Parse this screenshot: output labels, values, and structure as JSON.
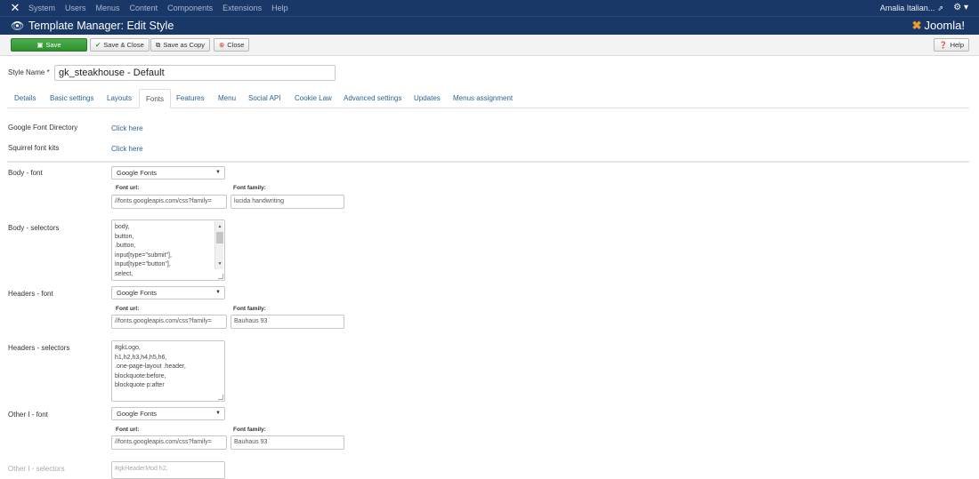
{
  "topnav": {
    "logo_icon": "joomla-x-icon",
    "menu": [
      "System",
      "Users",
      "Menus",
      "Content",
      "Components",
      "Extensions",
      "Help"
    ],
    "user": "Amalia Italian...",
    "settings_icon": "gear-icon"
  },
  "header": {
    "title": "Template Manager: Edit Style",
    "brand": "Joomla!"
  },
  "toolbar": {
    "save": "Save",
    "save_close": "Save & Close",
    "save_copy": "Save as Copy",
    "close": "Close",
    "help": "Help"
  },
  "style_name": {
    "label": "Style Name *",
    "value": "gk_steakhouse - Default"
  },
  "tabs": [
    "Details",
    "Basic settings",
    "Layouts",
    "Fonts",
    "Features",
    "Menu",
    "Social API",
    "Cookie Law",
    "Advanced settings",
    "Updates",
    "Menus assignment"
  ],
  "active_tab": "Fonts",
  "links": {
    "google_font_directory": {
      "label": "Google Font Directory",
      "link": "Click here"
    },
    "squirrel_font_kits": {
      "label": "Squirrel font kits",
      "link": "Click here"
    }
  },
  "fonts": {
    "font_url_label": "Font url:",
    "font_family_label": "Font family:",
    "body": {
      "label": "Body - font",
      "type": "Google Fonts",
      "url": "//fonts.googleapis.com/css?family=",
      "family": "lucida handwriting",
      "selectors_label": "Body - selectors",
      "selectors": [
        "body,",
        "button,",
        ".button,",
        "input[type=\"submit\"],",
        "input[type=\"button\"],",
        "select,"
      ]
    },
    "headers": {
      "label": "Headers - font",
      "type": "Google Fonts",
      "url": "//fonts.googleapis.com/css?family=",
      "family": "Bauhaus 93",
      "selectors_label": "Headers - selectors",
      "selectors": [
        "#gkLogo,",
        "h1,h2,h3,h4,h5,h6,",
        ".one-page-layout .header,",
        "blockquote:before,",
        "blockquote p:after"
      ]
    },
    "other1": {
      "label": "Other I - font",
      "type": "Google Fonts",
      "url": "//fonts.googleapis.com/css?family=",
      "family": "Bauhaus 93",
      "selectors_label": "Other I - selectors",
      "selectors": [
        "#gkHeaderMod h2,"
      ]
    }
  },
  "colors": {
    "nav_bg": "#1a3867",
    "save_green": "#3a9d3a",
    "link_blue": "#2a6496"
  }
}
